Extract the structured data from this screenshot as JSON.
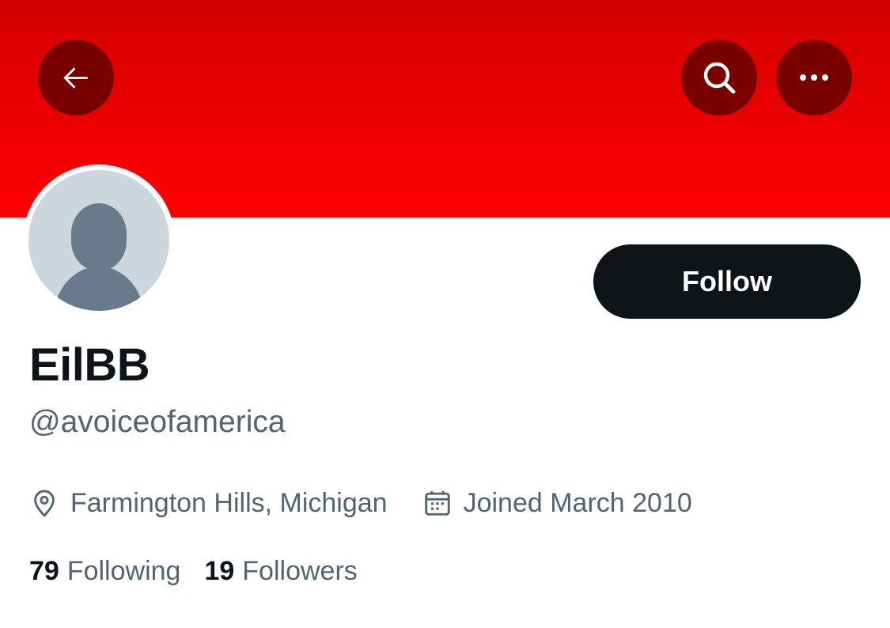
{
  "header": {
    "banner_color": "#e60000",
    "back_icon": "arrow-left-icon",
    "search_icon": "search-icon",
    "more_icon": "more-horizontal-icon"
  },
  "profile": {
    "avatar_icon": "default-avatar-icon",
    "display_name": "EilBB",
    "handle": "@avoiceofamerica",
    "follow_label": "Follow",
    "location": "Farmington Hills, Michigan",
    "location_icon": "location-pin-icon",
    "joined": "Joined March 2010",
    "joined_icon": "calendar-icon"
  },
  "stats": {
    "following_count": "79",
    "following_label": "Following",
    "followers_count": "19",
    "followers_label": "Followers"
  },
  "colors": {
    "text_primary": "#0f1419",
    "text_secondary": "#536471",
    "follow_button_bg": "#0f1419",
    "avatar_bg": "#ccd6dd"
  }
}
